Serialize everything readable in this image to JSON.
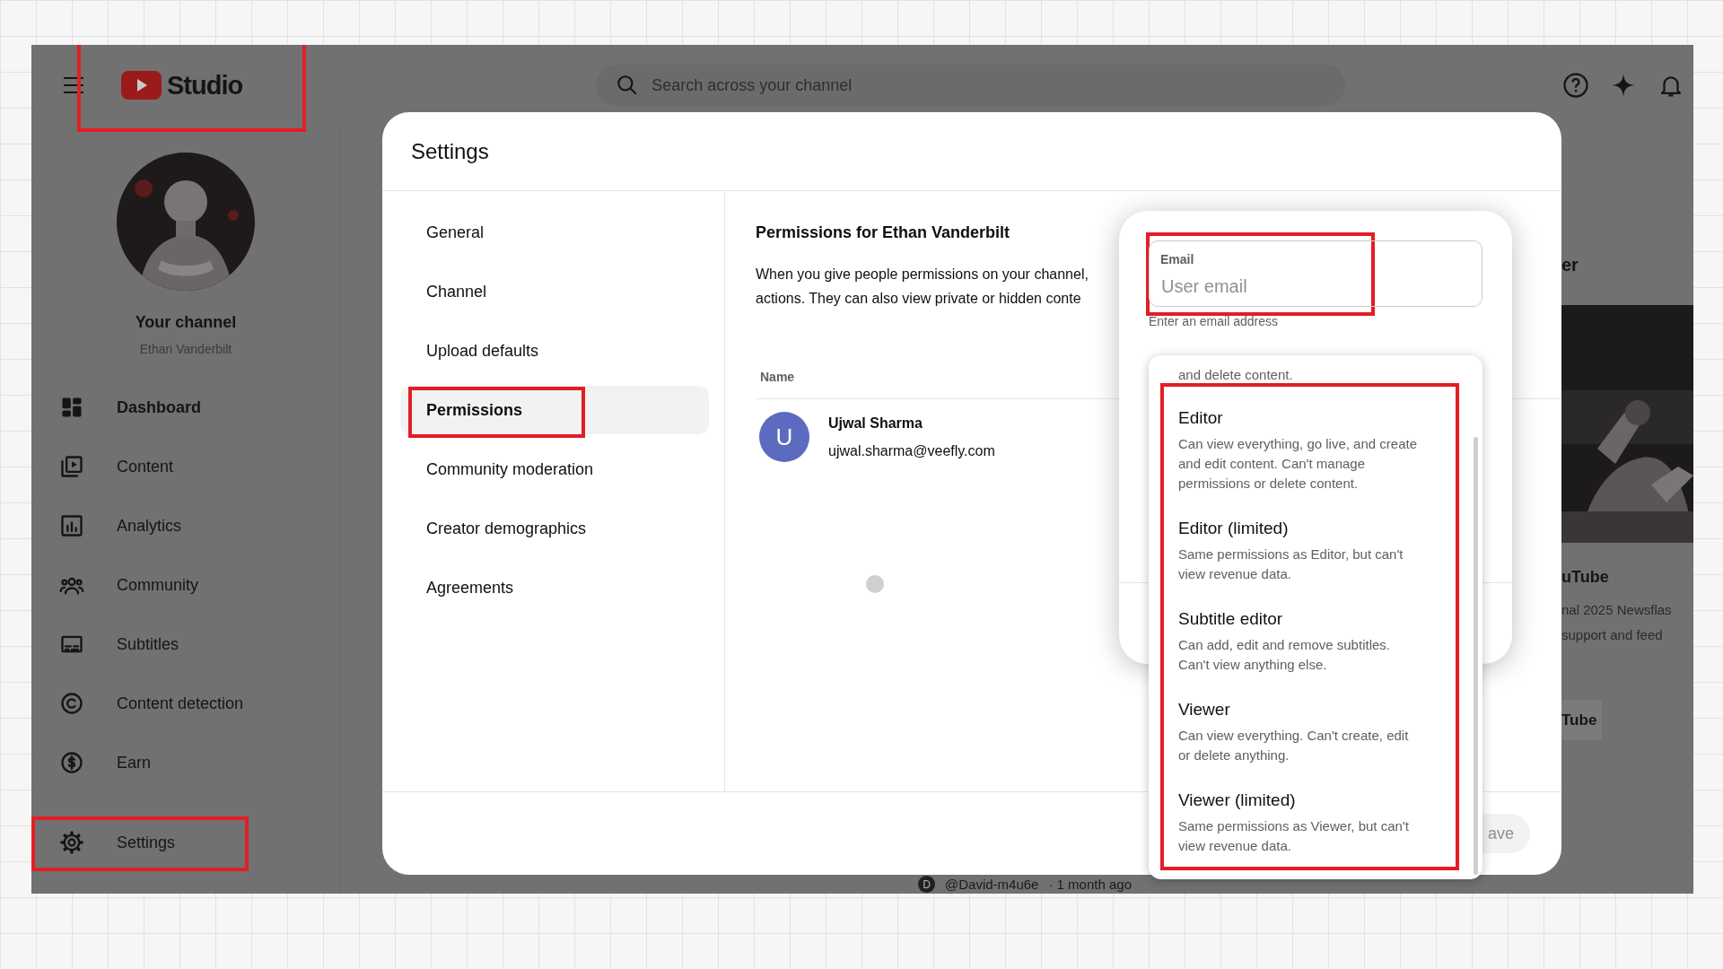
{
  "header": {
    "logo": {
      "text": "Studio",
      "highlighted": true
    },
    "search": {
      "placeholder": "Search across your channel"
    }
  },
  "sidebar": {
    "channel_title": "Your channel",
    "channel_name": "Ethan Vanderbilt",
    "items": [
      {
        "label": "Dashboard",
        "selected": true,
        "highlighted": false
      },
      {
        "label": "Content",
        "selected": false,
        "highlighted": false
      },
      {
        "label": "Analytics",
        "selected": false,
        "highlighted": false
      },
      {
        "label": "Community",
        "selected": false,
        "highlighted": false
      },
      {
        "label": "Subtitles",
        "selected": false,
        "highlighted": false
      },
      {
        "label": "Content detection",
        "selected": false,
        "highlighted": false
      },
      {
        "label": "Earn",
        "selected": false,
        "highlighted": false
      }
    ],
    "footer_items": [
      {
        "label": "Settings",
        "selected": false,
        "highlighted": true
      }
    ]
  },
  "dialog": {
    "title": "Settings",
    "nav": [
      {
        "label": "General",
        "selected": false,
        "highlighted": false
      },
      {
        "label": "Channel",
        "selected": false,
        "highlighted": false
      },
      {
        "label": "Upload defaults",
        "selected": false,
        "highlighted": false
      },
      {
        "label": "Permissions",
        "selected": true,
        "highlighted": true
      },
      {
        "label": "Community moderation",
        "selected": false,
        "highlighted": false
      },
      {
        "label": "Creator demographics",
        "selected": false,
        "highlighted": false
      },
      {
        "label": "Agreements",
        "selected": false,
        "highlighted": false
      }
    ],
    "heading": "Permissions for Ethan Vanderbilt",
    "description_lines": [
      "When you give people permissions on your channel,",
      "actions. They can also view private or hidden conte"
    ],
    "table": {
      "columns": [
        "Name"
      ],
      "rows": [
        {
          "initial": "U",
          "name": "Ujwal Sharma",
          "email": "ujwal.sharma@veefly.com",
          "color": "#5c6bc0"
        }
      ]
    },
    "save_button": "ave"
  },
  "invite": {
    "email": {
      "label": "Email",
      "placeholder": "User email",
      "hint": "Enter an email address",
      "highlighted": true
    },
    "roles": {
      "highlighted": true,
      "partial_lines": [
        "and delete content."
      ],
      "items": [
        {
          "title": "Editor",
          "lines": [
            "Can view everything, go live, and create",
            "and edit content. Can't manage",
            "permissions or delete content."
          ]
        },
        {
          "title": "Editor (limited)",
          "lines": [
            "Same permissions as Editor, but can't",
            "view revenue data."
          ]
        },
        {
          "title": "Subtitle editor",
          "lines": [
            "Can add, edit and remove subtitles.",
            "Can't view anything else."
          ]
        },
        {
          "title": "Viewer",
          "lines": [
            "Can view everything. Can't create, edit",
            "or delete anything."
          ]
        },
        {
          "title": "Viewer (limited)",
          "lines": [
            "Same permissions as Viewer, but can't",
            "view revenue data."
          ]
        }
      ]
    }
  },
  "background": {
    "peek_title": "er",
    "video_title": "uTube",
    "video_lines": [
      "nal 2025 Newsflas",
      "support and feed"
    ],
    "chip": "Tube",
    "comment": {
      "initial": "D",
      "author": "@David-m4u6e",
      "age": "· 1 month ago"
    }
  }
}
